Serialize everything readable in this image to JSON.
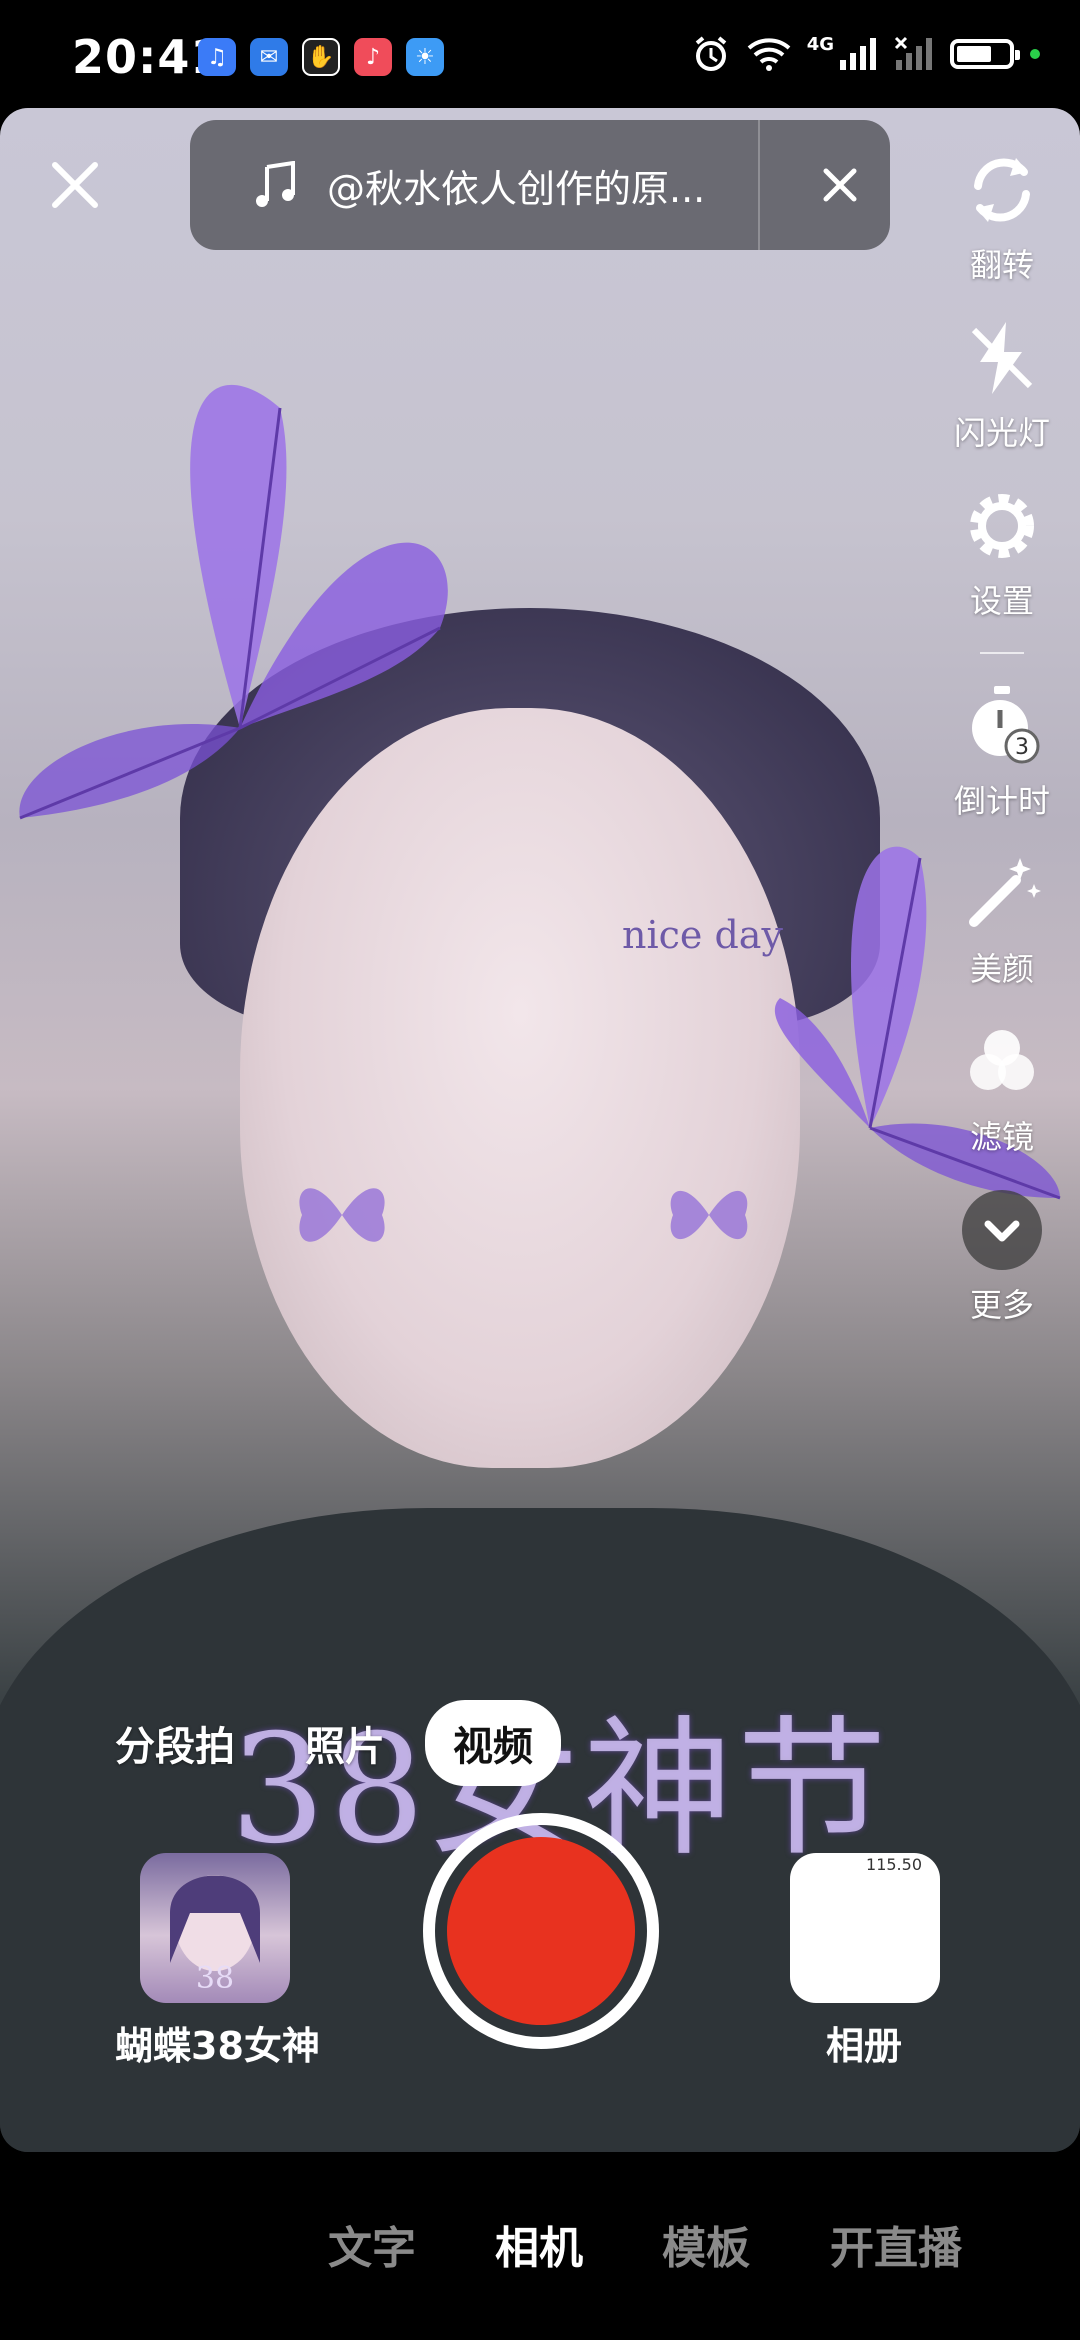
{
  "status_bar": {
    "time": "20:41",
    "network": "4G"
  },
  "music": {
    "title": "@秋水依人创作的原..."
  },
  "toolbar": {
    "flip": "翻转",
    "flash": "闪光灯",
    "settings": "设置",
    "timer": "倒计时",
    "beauty": "美颜",
    "filter": "滤镜",
    "more": "更多"
  },
  "modes": [
    "分段拍",
    "照片",
    "视频"
  ],
  "active_mode": "视频",
  "effect": {
    "label": "蝴蝶38女神"
  },
  "album": {
    "label": "相册",
    "tiny_text": "115.50"
  },
  "overlay": {
    "fest_text": "38女神节",
    "forehead_text": "nice day"
  },
  "bottom_nav": [
    "文字",
    "相机",
    "模板",
    "开直播"
  ],
  "bottom_nav_active": "相机",
  "colors": {
    "shutter": "#e8321f",
    "nav_inactive": "#8a8a8a"
  }
}
